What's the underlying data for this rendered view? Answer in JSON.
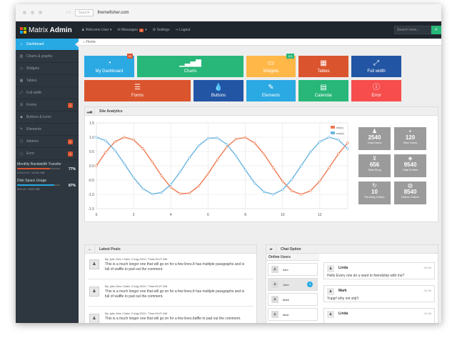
{
  "browser": {
    "search": "Search",
    "url": "themefisher.com"
  },
  "brand": {
    "word1": "Matrix",
    "word2": "Admin"
  },
  "topnav": {
    "welcome": "Welcome User",
    "messages": "Messages",
    "messages_count": "5",
    "settings": "Settings",
    "logout": "Logout"
  },
  "search": {
    "placeholder": "Search here..."
  },
  "breadcrumb": {
    "home": "Home"
  },
  "sidebar": {
    "items": [
      {
        "label": "Dashboard",
        "badge": ""
      },
      {
        "label": "Charts & graphs",
        "badge": ""
      },
      {
        "label": "Widgets",
        "badge": ""
      },
      {
        "label": "Tables",
        "badge": ""
      },
      {
        "label": "Full width",
        "badge": ""
      },
      {
        "label": "Forms",
        "badge": "3"
      },
      {
        "label": "Buttons & icons",
        "badge": ""
      },
      {
        "label": "Elements",
        "badge": ""
      },
      {
        "label": "Addons",
        "badge": "5"
      },
      {
        "label": "Error",
        "badge": "4"
      }
    ],
    "stats": [
      {
        "label": "Monthly Bandwidth Transfer",
        "percent": "77%",
        "value": 0.77,
        "detail": "21419.94 / 14000 MB"
      },
      {
        "label": "Disk Space Usage",
        "percent": "87%",
        "value": 0.87,
        "detail": "604.44 / 4000 MB"
      }
    ]
  },
  "tiles": [
    {
      "label": "My Dashboard",
      "badge": "20"
    },
    {
      "label": "Charts",
      "badge": ""
    },
    {
      "label": "Widgets",
      "badge": "101"
    },
    {
      "label": "Tables",
      "badge": ""
    },
    {
      "label": "Full width",
      "badge": ""
    },
    {
      "label": "Forms",
      "badge": ""
    },
    {
      "label": "Buttons",
      "badge": ""
    },
    {
      "label": "Elements",
      "badge": ""
    },
    {
      "label": "Calendar",
      "badge": ""
    },
    {
      "label": "Error",
      "badge": ""
    }
  ],
  "analytics": {
    "title": "Site Analytics",
    "stats": [
      {
        "value": "2540",
        "label": "Total Users"
      },
      {
        "value": "120",
        "label": "New Users"
      },
      {
        "value": "656",
        "label": "Total Shop"
      },
      {
        "value": "9540",
        "label": "Total Orders"
      },
      {
        "value": "10",
        "label": "Pending Orders"
      },
      {
        "value": "8540",
        "label": "Online Orders"
      }
    ]
  },
  "chart_data": {
    "type": "line",
    "xlim": [
      0,
      13.5
    ],
    "ylim": [
      -1.5,
      1.5
    ],
    "xticks": [
      0,
      2,
      4,
      6,
      8,
      10,
      12
    ],
    "yticks": [
      1.5,
      1.0,
      0.5,
      0.0,
      -0.5,
      -1.0,
      -1.5
    ],
    "ytick_labels": [
      "1.5",
      "1.0",
      "0.5",
      "0.0",
      "-0.5",
      "-1.0",
      "-1.5"
    ],
    "legend_position": "top-right",
    "series": [
      {
        "name": "sin(x)",
        "color": "#ee7951",
        "function": "sin",
        "x_step": 0.5,
        "x_max": 13.5
      },
      {
        "name": "cos(x)",
        "color": "#6bb5e0",
        "function": "cos",
        "x_step": 0.5,
        "x_max": 13.5
      }
    ]
  },
  "posts": {
    "title": "Latest Posts",
    "items": [
      {
        "meta": "By: john Deo / Date: 2 Aug 2012 / Time:09:27 AM",
        "body": "This is a much longer one that will go on for a few lines.It has multiple paragraphs and is full of waffle to pad out the comment."
      },
      {
        "meta": "By: john Deo / Date: 2 Aug 2012 / Time:09:27 AM",
        "body": "This is a much longer one that will go on for a few lines.It has multiple paragraphs and is full of waffle to pad out the comment."
      },
      {
        "meta": "By: john Deo / Date: 2 Aug 2012 / Time:09:27 AM",
        "body": "This is a much longer one that will go on for a few lines.Itaffle to pad out the comment."
      }
    ]
  },
  "chat": {
    "title": "Chat Option",
    "online_title": "Online Users",
    "users": [
      {
        "name": "Alex",
        "badge": ""
      },
      {
        "name": "John",
        "badge": "3"
      },
      {
        "name": "Mark",
        "badge": ""
      },
      {
        "name": "Maxi",
        "badge": ""
      }
    ],
    "messages": [
      {
        "name": "Linda",
        "time": "- 04:36",
        "text": "Hello Every one do u want to freindship with me?"
      },
      {
        "name": "Mark",
        "time": "- 04:36",
        "text": "Yuppi! why not sirji!!."
      },
      {
        "name": "Linda",
        "time": "- 04:36",
        "text": ""
      }
    ]
  }
}
